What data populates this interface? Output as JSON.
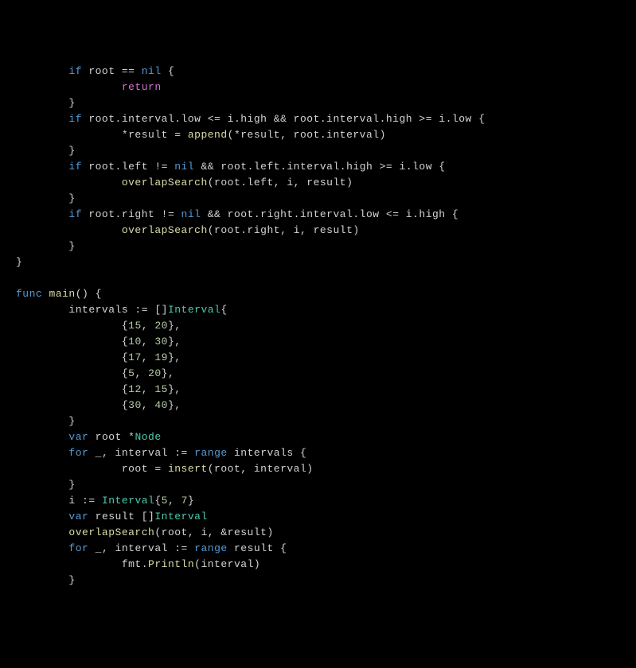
{
  "code": {
    "lines": [
      {
        "indent": 8,
        "parts": [
          {
            "t": "if ",
            "c": "keyword-if"
          },
          {
            "t": "root == ",
            "c": "text"
          },
          {
            "t": "nil",
            "c": "nil"
          },
          {
            "t": " {",
            "c": "text"
          }
        ]
      },
      {
        "indent": 16,
        "parts": [
          {
            "t": "return",
            "c": "keyword-return"
          }
        ]
      },
      {
        "indent": 8,
        "parts": [
          {
            "t": "}",
            "c": "text"
          }
        ]
      },
      {
        "indent": 8,
        "parts": [
          {
            "t": "if ",
            "c": "keyword-if"
          },
          {
            "t": "root.interval.low <= i.high && root.interval.high >= i.low {",
            "c": "text"
          }
        ]
      },
      {
        "indent": 16,
        "parts": [
          {
            "t": "*result = ",
            "c": "text"
          },
          {
            "t": "append",
            "c": "func-call"
          },
          {
            "t": "(*result, root.interval)",
            "c": "text"
          }
        ]
      },
      {
        "indent": 8,
        "parts": [
          {
            "t": "}",
            "c": "text"
          }
        ]
      },
      {
        "indent": 8,
        "parts": [
          {
            "t": "if ",
            "c": "keyword-if"
          },
          {
            "t": "root.left != ",
            "c": "text"
          },
          {
            "t": "nil",
            "c": "nil"
          },
          {
            "t": " && root.left.interval.high >= i.low {",
            "c": "text"
          }
        ]
      },
      {
        "indent": 16,
        "parts": [
          {
            "t": "overlapSearch",
            "c": "func-call"
          },
          {
            "t": "(root.left, i, result)",
            "c": "text"
          }
        ]
      },
      {
        "indent": 8,
        "parts": [
          {
            "t": "}",
            "c": "text"
          }
        ]
      },
      {
        "indent": 8,
        "parts": [
          {
            "t": "if ",
            "c": "keyword-if"
          },
          {
            "t": "root.right != ",
            "c": "text"
          },
          {
            "t": "nil",
            "c": "nil"
          },
          {
            "t": " && root.right.interval.low <= i.high {",
            "c": "text"
          }
        ]
      },
      {
        "indent": 16,
        "parts": [
          {
            "t": "overlapSearch",
            "c": "func-call"
          },
          {
            "t": "(root.right, i, result)",
            "c": "text"
          }
        ]
      },
      {
        "indent": 8,
        "parts": [
          {
            "t": "}",
            "c": "text"
          }
        ]
      },
      {
        "indent": 0,
        "parts": [
          {
            "t": "}",
            "c": "text"
          }
        ]
      },
      {
        "indent": 0,
        "parts": []
      },
      {
        "indent": 0,
        "parts": [
          {
            "t": "func ",
            "c": "keyword-func"
          },
          {
            "t": "main",
            "c": "func-name"
          },
          {
            "t": "() {",
            "c": "text"
          }
        ]
      },
      {
        "indent": 8,
        "parts": [
          {
            "t": "intervals := []",
            "c": "text"
          },
          {
            "t": "Interval",
            "c": "type"
          },
          {
            "t": "{",
            "c": "text"
          }
        ]
      },
      {
        "indent": 16,
        "parts": [
          {
            "t": "{",
            "c": "text"
          },
          {
            "t": "15",
            "c": "number"
          },
          {
            "t": ", ",
            "c": "text"
          },
          {
            "t": "20",
            "c": "number"
          },
          {
            "t": "},",
            "c": "text"
          }
        ]
      },
      {
        "indent": 16,
        "parts": [
          {
            "t": "{",
            "c": "text"
          },
          {
            "t": "10",
            "c": "number"
          },
          {
            "t": ", ",
            "c": "text"
          },
          {
            "t": "30",
            "c": "number"
          },
          {
            "t": "},",
            "c": "text"
          }
        ]
      },
      {
        "indent": 16,
        "parts": [
          {
            "t": "{",
            "c": "text"
          },
          {
            "t": "17",
            "c": "number"
          },
          {
            "t": ", ",
            "c": "text"
          },
          {
            "t": "19",
            "c": "number"
          },
          {
            "t": "},",
            "c": "text"
          }
        ]
      },
      {
        "indent": 16,
        "parts": [
          {
            "t": "{",
            "c": "text"
          },
          {
            "t": "5",
            "c": "number"
          },
          {
            "t": ", ",
            "c": "text"
          },
          {
            "t": "20",
            "c": "number"
          },
          {
            "t": "},",
            "c": "text"
          }
        ]
      },
      {
        "indent": 16,
        "parts": [
          {
            "t": "{",
            "c": "text"
          },
          {
            "t": "12",
            "c": "number"
          },
          {
            "t": ", ",
            "c": "text"
          },
          {
            "t": "15",
            "c": "number"
          },
          {
            "t": "},",
            "c": "text"
          }
        ]
      },
      {
        "indent": 16,
        "parts": [
          {
            "t": "{",
            "c": "text"
          },
          {
            "t": "30",
            "c": "number"
          },
          {
            "t": ", ",
            "c": "text"
          },
          {
            "t": "40",
            "c": "number"
          },
          {
            "t": "},",
            "c": "text"
          }
        ]
      },
      {
        "indent": 8,
        "parts": [
          {
            "t": "}",
            "c": "text"
          }
        ]
      },
      {
        "indent": 8,
        "parts": [
          {
            "t": "var ",
            "c": "keyword-var"
          },
          {
            "t": "root *",
            "c": "text"
          },
          {
            "t": "Node",
            "c": "type"
          }
        ]
      },
      {
        "indent": 8,
        "parts": [
          {
            "t": "for ",
            "c": "keyword-for"
          },
          {
            "t": "_, interval := ",
            "c": "text"
          },
          {
            "t": "range ",
            "c": "keyword-range"
          },
          {
            "t": "intervals {",
            "c": "text"
          }
        ]
      },
      {
        "indent": 16,
        "parts": [
          {
            "t": "root = ",
            "c": "text"
          },
          {
            "t": "insert",
            "c": "func-call"
          },
          {
            "t": "(root, interval)",
            "c": "text"
          }
        ]
      },
      {
        "indent": 8,
        "parts": [
          {
            "t": "}",
            "c": "text"
          }
        ]
      },
      {
        "indent": 8,
        "parts": [
          {
            "t": "i := ",
            "c": "text"
          },
          {
            "t": "Interval",
            "c": "type"
          },
          {
            "t": "{",
            "c": "text"
          },
          {
            "t": "5",
            "c": "number"
          },
          {
            "t": ", ",
            "c": "text"
          },
          {
            "t": "7",
            "c": "number"
          },
          {
            "t": "}",
            "c": "text"
          }
        ]
      },
      {
        "indent": 8,
        "parts": [
          {
            "t": "var ",
            "c": "keyword-var"
          },
          {
            "t": "result []",
            "c": "text"
          },
          {
            "t": "Interval",
            "c": "type"
          }
        ]
      },
      {
        "indent": 8,
        "parts": [
          {
            "t": "overlapSearch",
            "c": "func-call"
          },
          {
            "t": "(root, i, &result)",
            "c": "text"
          }
        ]
      },
      {
        "indent": 8,
        "parts": [
          {
            "t": "for ",
            "c": "keyword-for"
          },
          {
            "t": "_, interval := ",
            "c": "text"
          },
          {
            "t": "range ",
            "c": "keyword-range"
          },
          {
            "t": "result {",
            "c": "text"
          }
        ]
      },
      {
        "indent": 16,
        "parts": [
          {
            "t": "fmt.",
            "c": "text"
          },
          {
            "t": "Println",
            "c": "func-call"
          },
          {
            "t": "(interval)",
            "c": "text"
          }
        ]
      },
      {
        "indent": 8,
        "parts": [
          {
            "t": "}",
            "c": "text"
          }
        ]
      }
    ]
  }
}
